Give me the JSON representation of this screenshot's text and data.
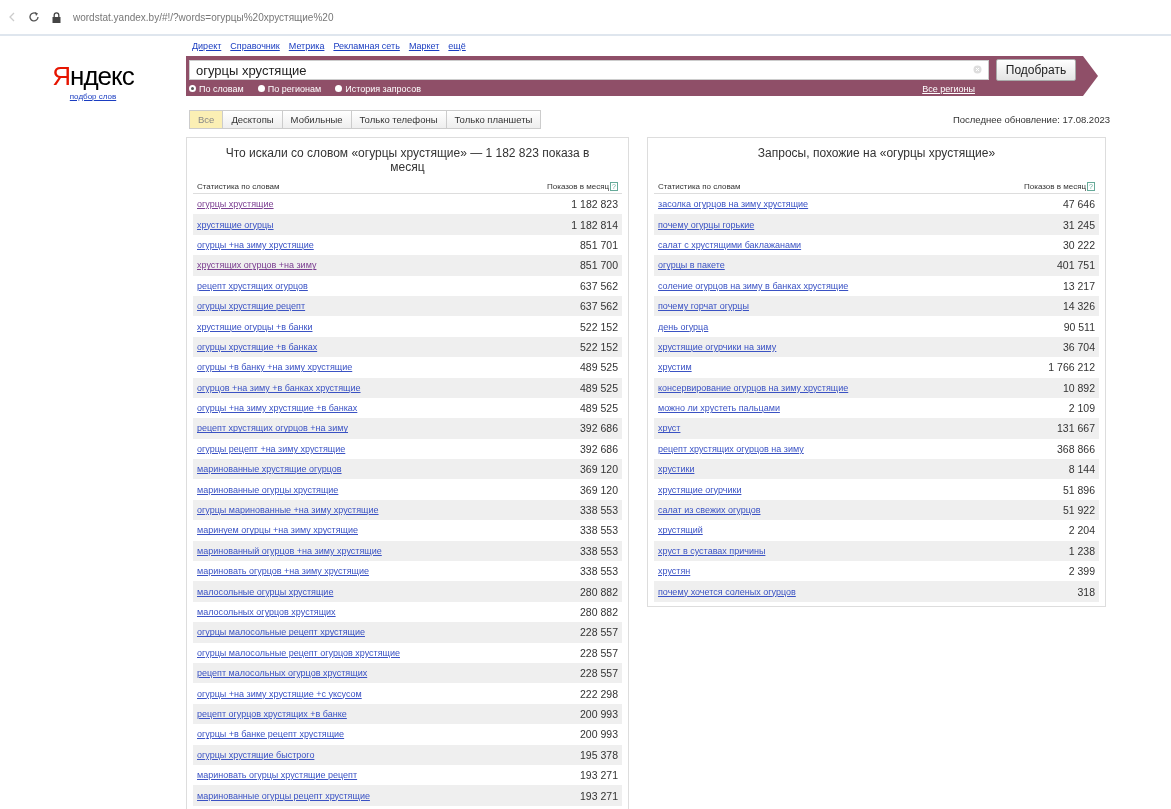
{
  "browser": {
    "url": "wordstat.yandex.by/#!/?words=огурцы%20хрустящие%20"
  },
  "logo": {
    "text": "Яндекс",
    "subtitle": "подбор слов"
  },
  "nav": [
    "Директ",
    "Справочник",
    "Метрика",
    "Рекламная сеть",
    "Маркет",
    "ещё"
  ],
  "search": {
    "value": "огурцы хрустящие",
    "button": "Подобрать",
    "region": "Все регионы",
    "modes": [
      {
        "label": "По словам",
        "selected": true
      },
      {
        "label": "По регионам",
        "selected": false
      },
      {
        "label": "История запросов",
        "selected": false
      }
    ]
  },
  "tabs": [
    {
      "label": "Все",
      "selected": true
    },
    {
      "label": "Десктопы",
      "selected": false
    },
    {
      "label": "Мобильные",
      "selected": false
    },
    {
      "label": "Только телефоны",
      "selected": false
    },
    {
      "label": "Только планшеты",
      "selected": false
    }
  ],
  "last_update": "Последнее обновление: 17.08.2023",
  "left_table": {
    "title": "Что искали со словом «огурцы хрустящие» — 1 182 823 показа в месяц",
    "columns": [
      "Статистика по словам",
      "Показов в месяц"
    ],
    "help": "?",
    "rows": [
      {
        "query": "огурцы хрустящие",
        "count": "1 182 823",
        "visited": true
      },
      {
        "query": "хрустящие огурцы",
        "count": "1 182 814",
        "visited": false
      },
      {
        "query": "огурцы +на зиму хрустящие",
        "count": "851 701",
        "visited": false
      },
      {
        "query": "хрустящих огурцов +на зиму",
        "count": "851 700",
        "visited": true
      },
      {
        "query": "рецепт хрустящих огурцов",
        "count": "637 562",
        "visited": false
      },
      {
        "query": "огурцы хрустящие рецепт",
        "count": "637 562",
        "visited": false
      },
      {
        "query": "хрустящие огурцы +в банки",
        "count": "522 152",
        "visited": false
      },
      {
        "query": "огурцы хрустящие +в банках",
        "count": "522 152",
        "visited": false
      },
      {
        "query": "огурцы +в банку +на зиму хрустящие",
        "count": "489 525",
        "visited": false
      },
      {
        "query": "огурцов +на зиму +в банках хрустящие",
        "count": "489 525",
        "visited": false
      },
      {
        "query": "огурцы +на зиму хрустящие +в банках",
        "count": "489 525",
        "visited": false
      },
      {
        "query": "рецепт хрустящих огурцов +на зиму",
        "count": "392 686",
        "visited": false
      },
      {
        "query": "огурцы рецепт +на зиму хрустящие",
        "count": "392 686",
        "visited": false
      },
      {
        "query": "маринованные хрустящие огурцов",
        "count": "369 120",
        "visited": false
      },
      {
        "query": "маринованные огурцы хрустящие",
        "count": "369 120",
        "visited": false
      },
      {
        "query": "огурцы маринованные +на зиму хрустящие",
        "count": "338 553",
        "visited": false
      },
      {
        "query": "маринуем огурцы +на зиму хрустящие",
        "count": "338 553",
        "visited": false
      },
      {
        "query": "маринованный огурцов +на зиму хрустящие",
        "count": "338 553",
        "visited": false
      },
      {
        "query": "мариновать огурцов +на зиму хрустящие",
        "count": "338 553",
        "visited": false
      },
      {
        "query": "малосольные огурцы хрустящие",
        "count": "280 882",
        "visited": false
      },
      {
        "query": "малосольных огурцов хрустящих",
        "count": "280 882",
        "visited": false
      },
      {
        "query": "огурцы малосольные рецепт хрустящие",
        "count": "228 557",
        "visited": false
      },
      {
        "query": "огурцы малосольные рецепт огурцов хрустящие",
        "count": "228 557",
        "visited": false
      },
      {
        "query": "рецепт малосольных огурцов хрустящих",
        "count": "228 557",
        "visited": false
      },
      {
        "query": "огурцы +на зиму хрустящие +с уксусом",
        "count": "222 298",
        "visited": false
      },
      {
        "query": "рецепт огурцов хрустящих +в банке",
        "count": "200 993",
        "visited": false
      },
      {
        "query": "огурцы +в банке рецепт хрустящие",
        "count": "200 993",
        "visited": false
      },
      {
        "query": "огурцы хрустящие быстрого",
        "count": "195 378",
        "visited": false
      },
      {
        "query": "мариновать огурцы хрустящие рецепт",
        "count": "193 271",
        "visited": false
      },
      {
        "query": "маринованные огурцы рецепт хрустящие",
        "count": "193 271",
        "visited": false
      }
    ]
  },
  "right_table": {
    "title": "Запросы, похожие на «огурцы хрустящие»",
    "columns": [
      "Статистика по словам",
      "Показов в месяц"
    ],
    "help": "?",
    "rows": [
      {
        "query": "засолка огурцов на зиму хрустящие",
        "count": "47 646",
        "visited": false
      },
      {
        "query": "почему огурцы горькие",
        "count": "31 245",
        "visited": false
      },
      {
        "query": "салат с хрустящими баклажанами",
        "count": "30 222",
        "visited": false
      },
      {
        "query": "огурцы в пакете",
        "count": "401 751",
        "visited": false
      },
      {
        "query": "соление огурцов на зиму в банках хрустящие",
        "count": "13 217",
        "visited": false
      },
      {
        "query": "почему горчат огурцы",
        "count": "14 326",
        "visited": false
      },
      {
        "query": "день огурца",
        "count": "90 511",
        "visited": false
      },
      {
        "query": "хрустящие огурчики на зиму",
        "count": "36 704",
        "visited": false
      },
      {
        "query": "хрустим",
        "count": "1 766 212",
        "visited": false
      },
      {
        "query": "консервирование огурцов на зиму хрустящие",
        "count": "10 892",
        "visited": false
      },
      {
        "query": "можно ли хрустеть пальцами",
        "count": "2 109",
        "visited": false
      },
      {
        "query": "хруст",
        "count": "131 667",
        "visited": false
      },
      {
        "query": "рецепт хрустящих огурцов на зиму",
        "count": "368 866",
        "visited": false
      },
      {
        "query": "хрустики",
        "count": "8 144",
        "visited": false
      },
      {
        "query": "хрустящие огурчики",
        "count": "51 896",
        "visited": false
      },
      {
        "query": "салат из свежих огурцов",
        "count": "51 922",
        "visited": false
      },
      {
        "query": "хрустящий",
        "count": "2 204",
        "visited": false
      },
      {
        "query": "хруст в суставах причины",
        "count": "1 238",
        "visited": false
      },
      {
        "query": "хрустян",
        "count": "2 399",
        "visited": false
      },
      {
        "query": "почему хочется соленых огурцов",
        "count": "318",
        "visited": false
      }
    ]
  }
}
